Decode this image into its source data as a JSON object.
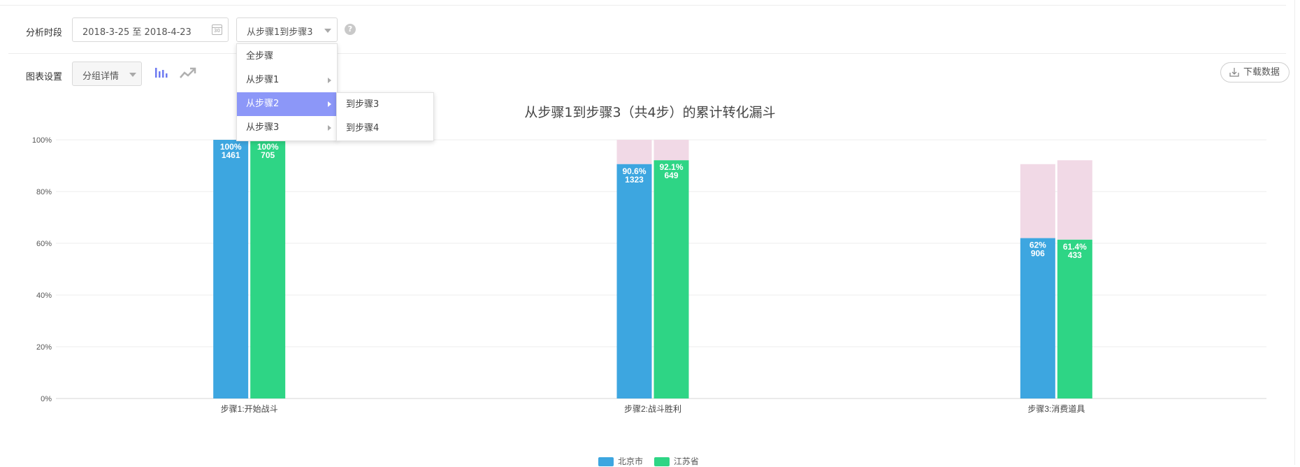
{
  "filters": {
    "period_label": "分析时段",
    "date_range": "2018-3-25 至 2018-4-23",
    "calendar_number": "30",
    "step_range_selected": "从步骤1到步骤3",
    "help_mark": "?",
    "chart_settings_label": "图表设置",
    "group_mode_selected": "分组详情"
  },
  "menu": {
    "items": [
      "全步骤",
      "从步骤1",
      "从步骤2",
      "从步骤3"
    ],
    "active_index": 2,
    "submenu": [
      "到步骤3",
      "到步骤4"
    ]
  },
  "toolbar": {
    "download_label": "下载数据"
  },
  "chart_data": {
    "type": "bar",
    "title": "从步骤1到步骤3（共4步）的累计转化漏斗",
    "categories": [
      "步骤1:开始战斗",
      "步骤2:战斗胜利",
      "步骤3:消费道具"
    ],
    "y_ticks": [
      "0%",
      "20%",
      "40%",
      "60%",
      "80%",
      "100%"
    ],
    "ylim": [
      0,
      100
    ],
    "series": [
      {
        "name": "北京市",
        "color": "#3da6e0",
        "values": [
          100,
          90.6,
          62
        ],
        "labels": [
          "100%",
          "90.6%",
          "62%"
        ],
        "counts": [
          "1461",
          "1323",
          "906"
        ],
        "remainder_top": [
          100,
          100,
          90.6
        ]
      },
      {
        "name": "江苏省",
        "color": "#2ed585",
        "values": [
          100,
          92.1,
          61.4
        ],
        "labels": [
          "100%",
          "92.1%",
          "61.4%"
        ],
        "counts": [
          "705",
          "649",
          "433"
        ],
        "remainder_top": [
          100,
          100,
          92.1
        ]
      }
    ],
    "remainder_color": "#f1d9e6",
    "grid": true,
    "legend_position": "bottom-center"
  }
}
